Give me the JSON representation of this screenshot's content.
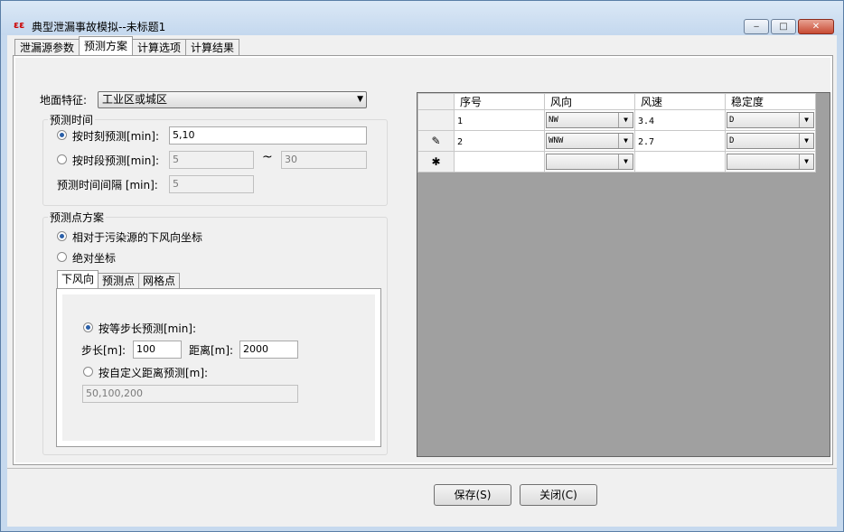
{
  "window": {
    "title": "典型泄漏事故模拟--未标题1",
    "icon_text": "ɛɛ",
    "buttons": {
      "min": "‒",
      "max": "□",
      "close": "✕"
    }
  },
  "tabs": [
    "泄漏源参数",
    "预测方案",
    "计算选项",
    "计算结果"
  ],
  "ground": {
    "label": "地面特征:",
    "value": "工业区或城区"
  },
  "time_group": {
    "title": "预测时间",
    "by_moment": {
      "label": "按时刻预测[min]:",
      "value": "5,10",
      "selected": true
    },
    "by_period": {
      "label": "按时段预测[min]:",
      "from": "5",
      "tilde": "~",
      "to": "30",
      "selected": false
    },
    "interval": {
      "label": "预测时间间隔 [min]:",
      "value": "5"
    }
  },
  "point_group": {
    "title": "预测点方案",
    "relative": {
      "label": "相对于污染源的下风向坐标",
      "selected": true
    },
    "absolute": {
      "label": "绝对坐标",
      "selected": false
    },
    "subtabs": [
      "下风向",
      "预测点",
      "网格点"
    ],
    "equal_step": {
      "label": "按等步长预测[min]:",
      "selected": true
    },
    "step": {
      "label": "步长[m]:",
      "value": "100"
    },
    "distance": {
      "label": "距离[m]:",
      "value": "2000"
    },
    "custom": {
      "label": "按自定义距离预测[m]:",
      "value": "50,100,200",
      "selected": false
    }
  },
  "grid": {
    "headers": [
      "序号",
      "风向",
      "风速",
      "稳定度"
    ],
    "rows": [
      {
        "marker": "",
        "seq": "1",
        "dir": "NW",
        "speed": "3.4",
        "stab": "D"
      },
      {
        "marker": "✎",
        "seq": "2",
        "dir": "WNW",
        "speed": "2.7",
        "stab": "D"
      },
      {
        "marker": "✱",
        "seq": "",
        "dir": "",
        "speed": "",
        "stab": ""
      }
    ]
  },
  "footer": {
    "save": "保存(S)",
    "close": "关闭(C)"
  },
  "icons": {
    "dropdown": "▼"
  }
}
